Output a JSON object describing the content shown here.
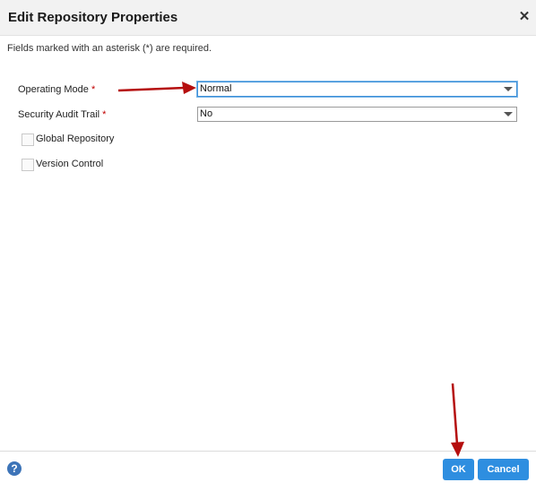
{
  "dialog": {
    "title": "Edit Repository Properties",
    "close_icon": "close-icon",
    "required_note": "Fields marked with an asterisk (*) are required."
  },
  "form": {
    "operating_mode": {
      "label": "Operating Mode",
      "required_marker": "*",
      "value": "Normal"
    },
    "security_audit_trail": {
      "label": "Security Audit Trail",
      "required_marker": "*",
      "value": "No"
    },
    "global_repository": {
      "label": "Global Repository",
      "checked": false
    },
    "version_control": {
      "label": "Version Control",
      "checked": false
    }
  },
  "footer": {
    "help_icon": "help-icon",
    "help_glyph": "?",
    "ok_label": "OK",
    "cancel_label": "Cancel"
  },
  "annotations": {
    "arrow_color": "#b50e0e"
  },
  "colors": {
    "accent": "#2e8ee0",
    "header_bg": "#f2f2f2",
    "required": "#c00000"
  }
}
